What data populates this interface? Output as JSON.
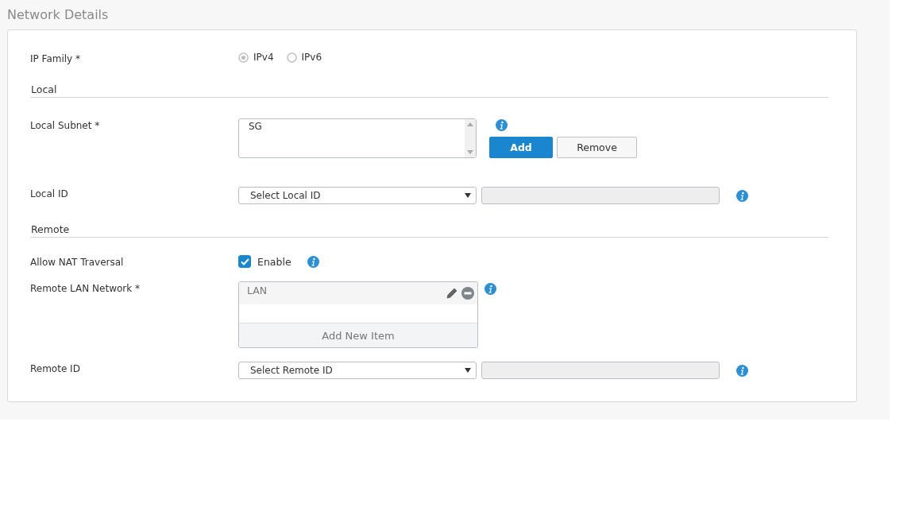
{
  "title": "Network Details",
  "rows": [
    {
      "kind": "radio",
      "label": "IP Family *",
      "options": [
        {
          "label": "IPv4",
          "selected": true
        },
        {
          "label": "IPv6",
          "selected": false
        }
      ]
    },
    {
      "kind": "heading",
      "label": "Local"
    },
    {
      "kind": "listbox",
      "label": "Local Subnet *",
      "items": [
        "SG"
      ],
      "buttons": [
        {
          "label": "Add",
          "primary": true
        },
        {
          "label": "Remove",
          "primary": false
        }
      ]
    },
    {
      "kind": "id_select",
      "label": "Local ID",
      "placeholder": "Select Local ID"
    },
    {
      "kind": "heading",
      "label": "Remote"
    },
    {
      "kind": "checkbox",
      "label": "Allow NAT Traversal",
      "option": "Enable",
      "checked": true
    },
    {
      "kind": "item_list",
      "label": "Remote LAN Network *",
      "items": [
        "LAN"
      ],
      "add_label": "Add New Item"
    },
    {
      "kind": "id_select",
      "label": "Remote ID",
      "placeholder": "Select Remote ID"
    }
  ]
}
